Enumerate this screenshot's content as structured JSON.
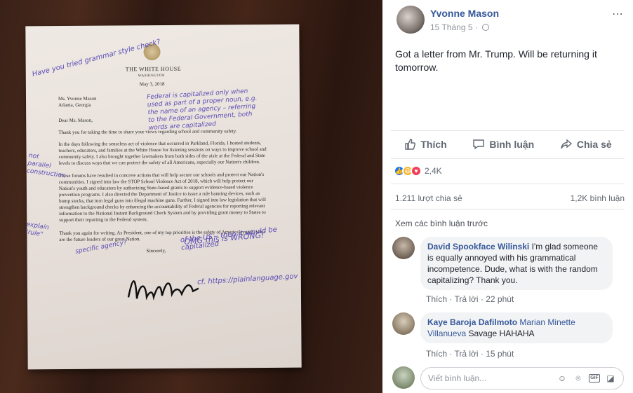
{
  "letter": {
    "header_title": "THE WHITE HOUSE",
    "header_city": "WASHINGTON",
    "date": "May 3, 2018",
    "recipient_name": "Ms. Yvonne Mason",
    "recipient_city": "Atlanta, Georgia",
    "greeting": "Dear Ms. Mason,",
    "para1": "Thank you for taking the time to share your views regarding school and community safety.",
    "para2": "In the days following the senseless act of violence that occurred in Parkland, Florida, I hosted students, teachers, educators, and families at the White House for listening sessions on ways to improve school and community safety. I also brought together lawmakers from both sides of the aisle at the Federal and State levels to discuss ways that we can protect the safety of all Americans, especially our Nation's children.",
    "para3": "These forums have resulted in concrete actions that will help secure our schools and protect our Nation's communities. I signed into law the STOP School Violence Act of 2018, which will help protect our Nation's youth and educators by authorizing State-based grants to support evidence-based violence prevention programs. I also directed the Department of Justice to issue a rule banning devices, such as bump stocks, that turn legal guns into illegal machine guns. Further, I signed into law legislation that will strengthen background checks by enhancing the accountability of Federal agencies for reporting relevant information to the National Instant Background Check System and by providing grant money to States to support their reporting to the Federal system.",
    "para4": "Thank you again for writing. As President, one of my top priorities is the safety of America's youth, who are the future leaders of our great Nation.",
    "closing": "Sincerely,"
  },
  "annotations": {
    "grammar_check": "Have you tried grammar style check?",
    "capitalized_note": "Federal is capitalized only when used as part of a proper noun, e.g. the name of an agency – referring to the Federal Government, both words are capitalized",
    "not_parallel": "not parallel construction",
    "explain_rule": "explain \"rule\"",
    "specific_agency": "specific agency?",
    "of_the_us": "of the US – then it would be capitalized",
    "omg": "OMG this is WRONG!",
    "plain_language": "cf. https://plainlanguage.gov"
  },
  "post": {
    "author": "Yvonne Mason",
    "timestamp": "15 Tháng 5",
    "text": "Got a letter from Mr. Trump. Will be returning it tomorrow.",
    "actions": {
      "like": "Thích",
      "comment": "Bình luận",
      "share": "Chia sẻ"
    },
    "reaction_count": "2,4K",
    "share_count": "1.211 lượt chia sẻ",
    "comment_count": "1,2K bình luận",
    "see_previous": "Xem các bình luận trước",
    "comments": [
      {
        "author": "David Spookface Wilinski",
        "tag": "",
        "text": "I'm glad someone is equally annoyed with his grammatical incompetence. Dude, what is with the random capitalizing? Thank you.",
        "like": "Thích",
        "reply": "Trả lời",
        "time": "22 phút"
      },
      {
        "author": "Kaye Baroja Dafilmoto",
        "tag": "Marian Minette Villanueva",
        "text": "Savage HAHAHA",
        "like": "Thích",
        "reply": "Trả lời",
        "time": "15 phút"
      }
    ],
    "compose_placeholder": "Viết bình luận..."
  }
}
